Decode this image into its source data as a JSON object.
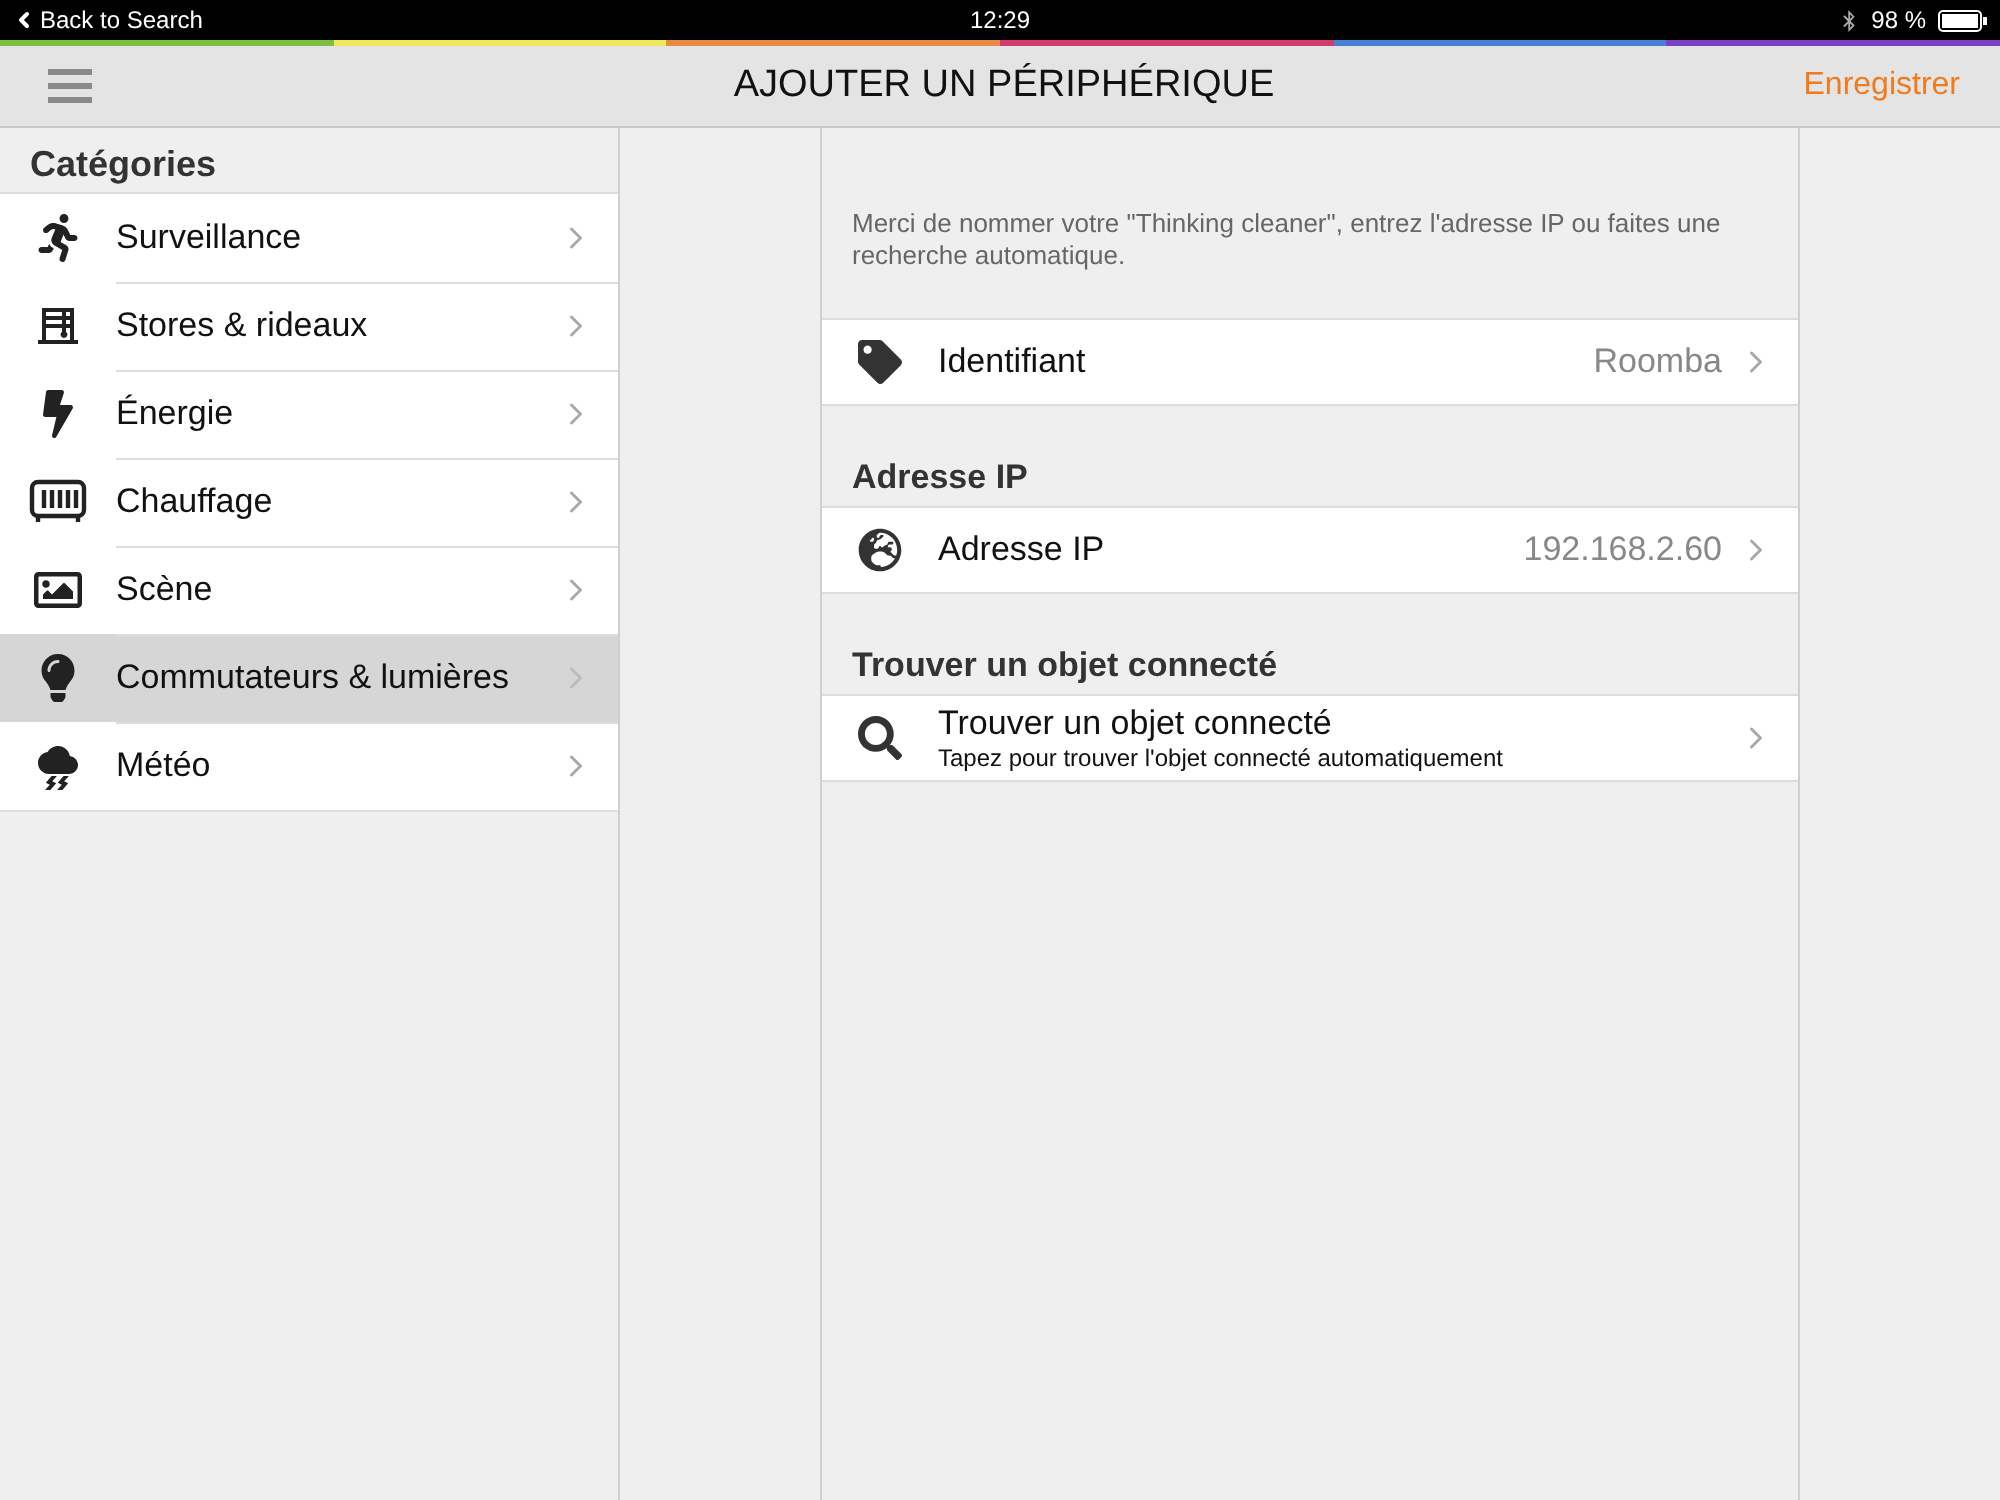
{
  "status_bar": {
    "back": "Back to Search",
    "time": "12:29",
    "battery": "98 %"
  },
  "nav_bar": {
    "title": "AJOUTER UN PÉRIPHÉRIQUE",
    "action": "Enregistrer"
  },
  "sidebar": {
    "title": "Catégories",
    "items": [
      {
        "label": "Surveillance",
        "selected": false
      },
      {
        "label": "Stores & rideaux",
        "selected": false
      },
      {
        "label": "Énergie",
        "selected": false
      },
      {
        "label": "Chauffage",
        "selected": false
      },
      {
        "label": "Scène",
        "selected": false
      },
      {
        "label": "Commutateurs & lumières",
        "selected": true
      },
      {
        "label": "Météo",
        "selected": false
      }
    ]
  },
  "form": {
    "intro": "Merci de nommer votre \"Thinking cleaner\", entrez l'adresse IP ou faites une recherche automatique.",
    "sections": [
      {
        "rows": [
          {
            "label": "Identifiant",
            "value": "Roomba"
          }
        ]
      },
      {
        "header": "Adresse IP",
        "rows": [
          {
            "label": "Adresse IP",
            "value": "192.168.2.60"
          }
        ]
      },
      {
        "header": "Trouver un objet connecté",
        "rows": [
          {
            "label": "Trouver un objet connecté",
            "subtitle": "Tapez pour trouver l'objet connecté automatiquement"
          }
        ]
      }
    ]
  }
}
